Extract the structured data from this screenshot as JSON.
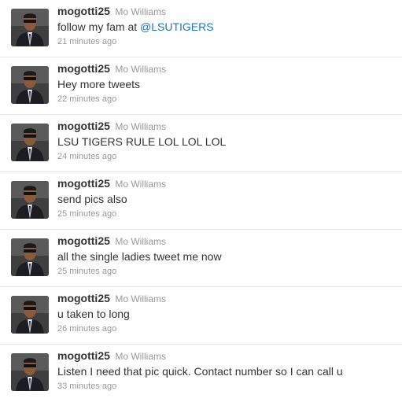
{
  "tweets": [
    {
      "screen_name": "mogotti25",
      "full_name": "Mo Williams",
      "text": "follow my fam at ",
      "mention": "@LSUTIGERS",
      "time": "21 minutes ago"
    },
    {
      "screen_name": "mogotti25",
      "full_name": "Mo Williams",
      "text": "Hey more tweets",
      "mention": "",
      "time": "22 minutes ago"
    },
    {
      "screen_name": "mogotti25",
      "full_name": "Mo Williams",
      "text": "LSU TIGERS RULE LOL LOL LOL",
      "mention": "",
      "time": "24 minutes ago"
    },
    {
      "screen_name": "mogotti25",
      "full_name": "Mo Williams",
      "text": "send pics also",
      "mention": "",
      "time": "25 minutes ago"
    },
    {
      "screen_name": "mogotti25",
      "full_name": "Mo Williams",
      "text": "all the single ladies tweet me now",
      "mention": "",
      "time": "25 minutes ago"
    },
    {
      "screen_name": "mogotti25",
      "full_name": "Mo Williams",
      "text": "u taken to long",
      "mention": "",
      "time": "26 minutes ago"
    },
    {
      "screen_name": "mogotti25",
      "full_name": "Mo Williams",
      "text": "Listen I need that pic quick. Contact number so I can call u",
      "mention": "",
      "time": "33 minutes ago"
    }
  ],
  "colors": {
    "screen_name": "#333333",
    "full_name": "#999999",
    "mention": "#2276bb",
    "timestamp": "#999999",
    "divider": "#e8e8e8"
  },
  "icons": {
    "avatar": "profile-photo-icon"
  }
}
